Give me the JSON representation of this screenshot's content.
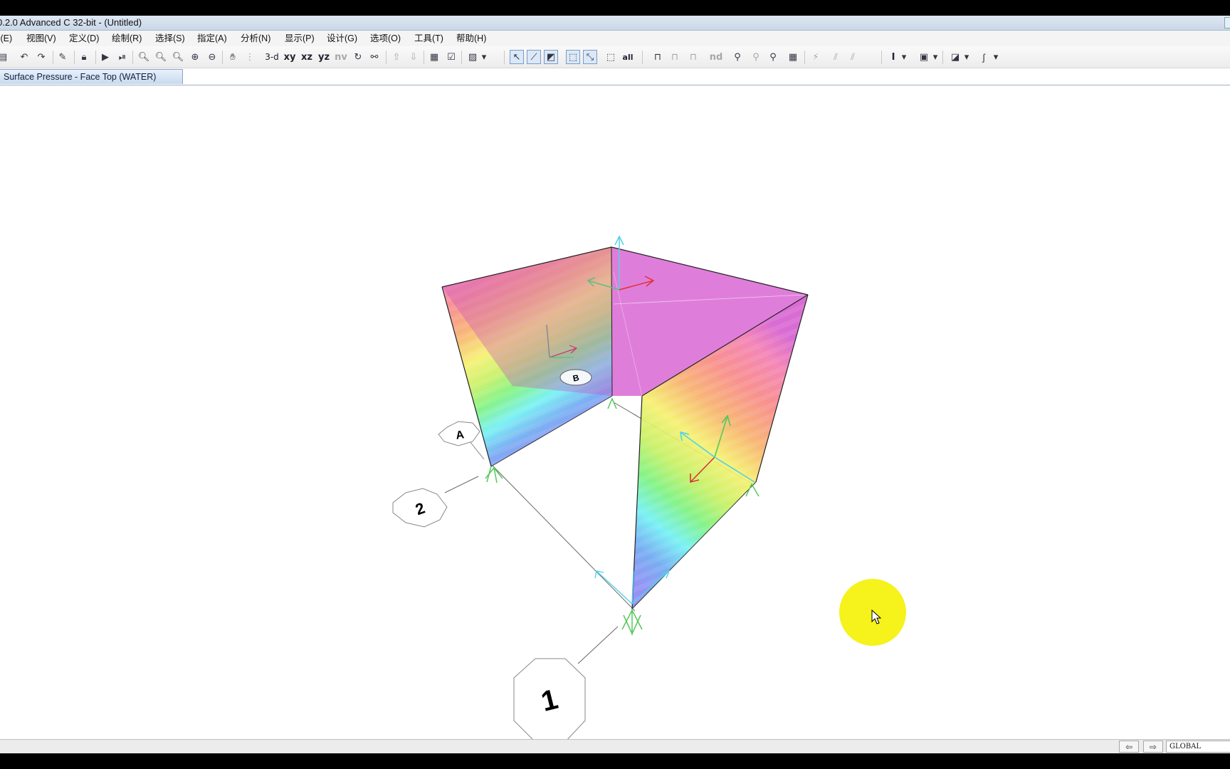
{
  "window": {
    "title": "0.2.0 Advanced C 32-bit - (Untitled)"
  },
  "menubar": {
    "items": [
      {
        "label": "辑(E)"
      },
      {
        "label": "视图(V)"
      },
      {
        "label": "定义(D)"
      },
      {
        "label": "绘制(R)"
      },
      {
        "label": "选择(S)"
      },
      {
        "label": "指定(A)"
      },
      {
        "label": "分析(N)"
      },
      {
        "label": "显示(P)"
      },
      {
        "label": "设计(G)"
      },
      {
        "label": "选项(O)"
      },
      {
        "label": "工具(T)"
      },
      {
        "label": "帮助(H)"
      }
    ]
  },
  "toolbar": {
    "view_3d": "3-d",
    "view_xy": "xy",
    "view_xz": "xz",
    "view_yz": "yz",
    "view_nv": "nv",
    "select_all": "all",
    "nd": "nd",
    "text_tool": "I"
  },
  "tab": {
    "label": "Surface Pressure - Face Top (WATER)"
  },
  "model": {
    "grid_labels": {
      "a": "A",
      "b": "B",
      "two": "2",
      "one": "1"
    },
    "colors": {
      "magenta": "#d65fd0",
      "contour": [
        "#8f86f3",
        "#6ea6f2",
        "#6ef0f3",
        "#7af27e",
        "#c6f060",
        "#f5f06a",
        "#f7b06a",
        "#f78787",
        "#f37cb0"
      ]
    }
  },
  "statusbar": {
    "coord_system": "GLOBAL"
  }
}
